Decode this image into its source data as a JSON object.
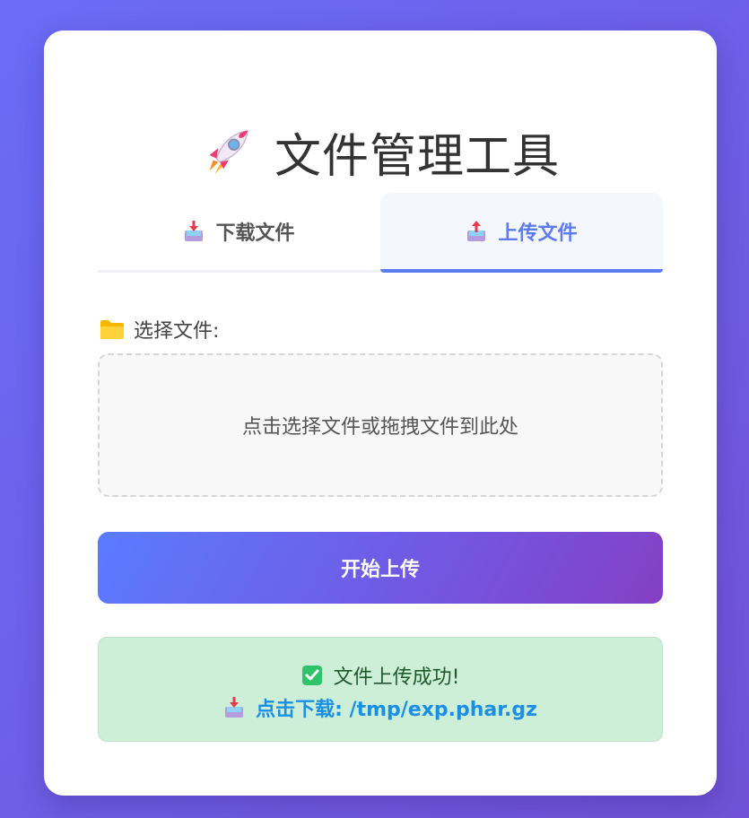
{
  "header": {
    "title": "文件管理工具",
    "icon": "rocket-icon"
  },
  "tabs": [
    {
      "label": "下载文件",
      "icon": "inbox-tray-icon",
      "active": false
    },
    {
      "label": "上传文件",
      "icon": "outbox-tray-icon",
      "active": true
    }
  ],
  "form": {
    "file_label": "选择文件:",
    "file_label_icon": "folder-icon",
    "dropzone_text": "点击选择文件或拖拽文件到此处",
    "submit_label": "开始上传"
  },
  "result": {
    "message": "文件上传成功!",
    "message_icon": "check-mark-icon",
    "download_link": "点击下载: /tmp/exp.phar.gz",
    "download_icon": "inbox-tray-icon"
  },
  "colors": {
    "accent": "#5b7cf0",
    "success_bg": "#cdeed7",
    "link": "#1a8fe6"
  }
}
